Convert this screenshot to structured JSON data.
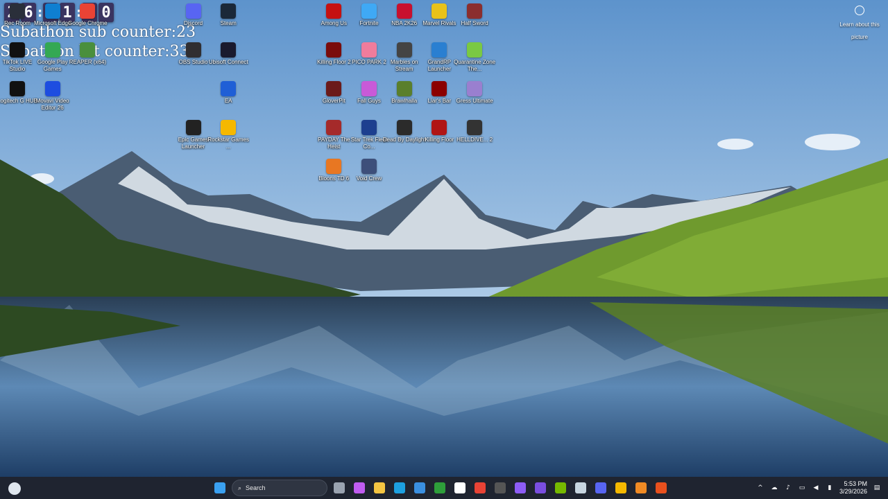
{
  "timer": {
    "digits": [
      "2",
      "6",
      "3",
      "1",
      "0",
      "0"
    ]
  },
  "overlay": {
    "sub_counter": "Subathon sub counter:23",
    "bit_counter": "Subathon bit counter:330"
  },
  "learn_more": {
    "label": "Learn about this picture"
  },
  "desktop_icons": [
    {
      "label": "Rec Room",
      "color": "#2a2f3a"
    },
    {
      "label": "Microsoft Edge",
      "color": "#0f7fd1"
    },
    {
      "label": "Google Chrome",
      "color": "#e94335"
    },
    {
      "label": "Discord",
      "color": "#5865f2"
    },
    {
      "label": "Steam",
      "color": "#1b2838"
    },
    {
      "label": "TikTok LIVE Studio",
      "color": "#111111"
    },
    {
      "label": "Google Play Games",
      "color": "#34a853"
    },
    {
      "label": "REAPER (x64)",
      "color": "#4a8f3c"
    },
    {
      "label": "OBS Studio",
      "color": "#302e31"
    },
    {
      "label": "Ubisoft Connect",
      "color": "#1a1a2e"
    },
    {
      "label": "Logitech G HUB",
      "color": "#111111"
    },
    {
      "label": "Movavi Video Editor 26",
      "color": "#1d4de0"
    },
    {
      "label": "EA",
      "color": "#1f5fd6"
    },
    {
      "label": "Epic Games Launcher",
      "color": "#222222"
    },
    {
      "label": "Rockstar Games ...",
      "color": "#f5b800"
    },
    {
      "label": "Among Us",
      "color": "#c51111"
    },
    {
      "label": "Fortnite",
      "color": "#3fa9f5"
    },
    {
      "label": "NBA 2K26",
      "color": "#c8102e"
    },
    {
      "label": "Marvel Rivals",
      "color": "#e8c21a"
    },
    {
      "label": "Half Sword",
      "color": "#8b2e2e"
    },
    {
      "label": "Killing Floor 2",
      "color": "#7a0c0c"
    },
    {
      "label": "PICO PARK 2",
      "color": "#f07c9c"
    },
    {
      "label": "Marbles on Stream",
      "color": "#444444"
    },
    {
      "label": "GrandRP Launcher",
      "color": "#2a7fd1"
    },
    {
      "label": "Quarantine Zone The...",
      "color": "#7ac943"
    },
    {
      "label": "GloverPit",
      "color": "#6b1a1a"
    },
    {
      "label": "Fall Guys",
      "color": "#c85ad8"
    },
    {
      "label": "Brawlhalla",
      "color": "#5a7f2c"
    },
    {
      "label": "Liar's Bar",
      "color": "#8b0000"
    },
    {
      "label": "Gress Ultimate",
      "color": "#9a7fcf"
    },
    {
      "label": "PAYDAY The Heist",
      "color": "#a52a2a"
    },
    {
      "label": "Star Trek Fleet Co...",
      "color": "#1d3f8f"
    },
    {
      "label": "Dead By Daylight",
      "color": "#2b2b2b"
    },
    {
      "label": "Killing Floor",
      "color": "#b01515"
    },
    {
      "label": "HELLDIVE... 2",
      "color": "#333333"
    },
    {
      "label": "Bloons TD 6",
      "color": "#e87722"
    },
    {
      "label": "Void Crew",
      "color": "#3d4f7a"
    }
  ],
  "taskbar": {
    "search_placeholder": "Search",
    "apps": [
      {
        "name": "start",
        "color": "#3aa0f0"
      },
      {
        "name": "task-view",
        "color": "#9aa3b0"
      },
      {
        "name": "copilot",
        "color": "#c05cf0"
      },
      {
        "name": "file-explorer",
        "color": "#f4c542"
      },
      {
        "name": "edge",
        "color": "#1da0e0"
      },
      {
        "name": "store",
        "color": "#3a8fe0"
      },
      {
        "name": "xbox",
        "color": "#2e9e3a"
      },
      {
        "name": "notepad",
        "color": "#ffffff"
      },
      {
        "name": "chrome",
        "color": "#e94335"
      },
      {
        "name": "obs",
        "color": "#555555"
      },
      {
        "name": "twitch-studio",
        "color": "#8d5cf6"
      },
      {
        "name": "clipchamp",
        "color": "#7a4ee0"
      },
      {
        "name": "nvidia",
        "color": "#76b900"
      },
      {
        "name": "steam",
        "color": "#c7d5e0"
      },
      {
        "name": "discord",
        "color": "#5865f2"
      },
      {
        "name": "rockstar",
        "color": "#f5b800"
      },
      {
        "name": "affinity",
        "color": "#f08a24"
      },
      {
        "name": "brave",
        "color": "#e8501d"
      }
    ],
    "time": "5:53 PM",
    "date": "3/29/2026"
  }
}
